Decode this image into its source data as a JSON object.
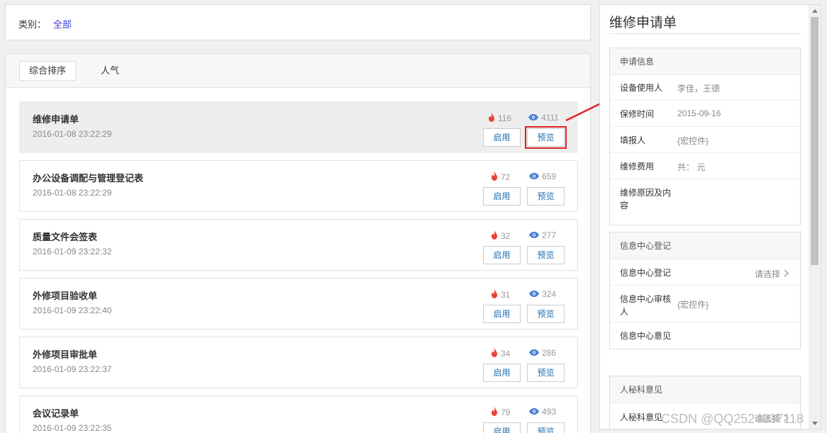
{
  "filter": {
    "label": "类别：",
    "value": "全部"
  },
  "sort_tabs": [
    "综合排序",
    "人气"
  ],
  "forms": [
    {
      "title": "维修申请单",
      "date": "2016-01-08 23:22:29",
      "hot": "116",
      "views": "4111"
    },
    {
      "title": "办公设备调配与管理登记表",
      "date": "2016-01-08 23:22:29",
      "hot": "72",
      "views": "659"
    },
    {
      "title": "质量文件会签表",
      "date": "2016-01-09 23:22:32",
      "hot": "32",
      "views": "277"
    },
    {
      "title": "外修项目验收单",
      "date": "2016-01-09 23:22:40",
      "hot": "31",
      "views": "324"
    },
    {
      "title": "外修项目审批单",
      "date": "2016-01-09 23:22:37",
      "hot": "34",
      "views": "286"
    },
    {
      "title": "会议记录单",
      "date": "2016-01-09 23:22:35",
      "hot": "79",
      "views": "493"
    }
  ],
  "buttons": {
    "enable": "启用",
    "preview": "预览"
  },
  "preview_panel": {
    "title": "维修申请单",
    "sections": [
      {
        "heading": "申请信息",
        "rows": [
          {
            "label": "设备使用人",
            "value": "李佳，王德"
          },
          {
            "label": "保修时间",
            "value": "2015-09-16"
          },
          {
            "label": "填报人",
            "value": "{宏控件}"
          },
          {
            "label": "维修费用",
            "value": "共：  元"
          },
          {
            "label": "维修原因及内容",
            "value": ""
          }
        ]
      },
      {
        "heading": "信息中心登记",
        "rows": [
          {
            "label": "信息中心登记",
            "value": "请选择"
          },
          {
            "label": "信息中心审核人",
            "value": "{宏控件}"
          },
          {
            "label": "信息中心意见",
            "value": ""
          }
        ]
      },
      {
        "heading": "人秘科意见",
        "rows": [
          {
            "label": "人秘科意见",
            "value": "请选择"
          }
        ]
      }
    ]
  },
  "watermark": "CSDN @QQ2524837118",
  "colors": {
    "hot": "#e8433a",
    "view": "#4a7fd4",
    "highlight": "#e02323",
    "link": "#3b3bd6"
  }
}
